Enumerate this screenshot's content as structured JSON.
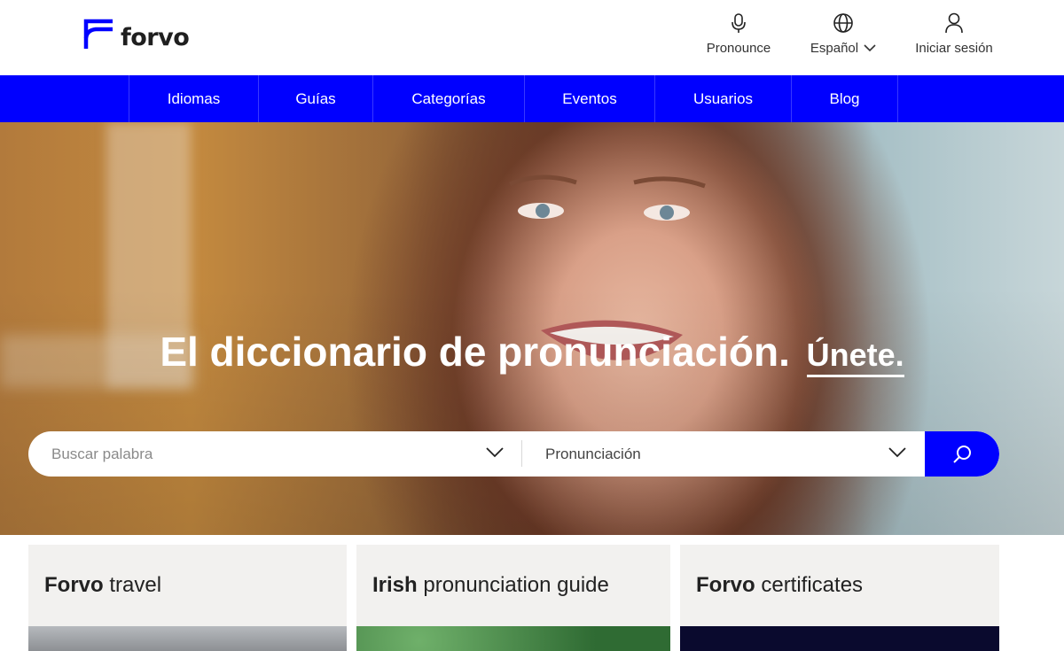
{
  "brand": {
    "name": "forvo",
    "color": "#0000ff"
  },
  "header": {
    "pronounce_label": "Pronounce",
    "language_label": "Español",
    "login_label": "Iniciar sesión"
  },
  "nav": {
    "items": [
      {
        "label": "Idiomas"
      },
      {
        "label": "Guías"
      },
      {
        "label": "Categorías"
      },
      {
        "label": "Eventos"
      },
      {
        "label": "Usuarios"
      },
      {
        "label": "Blog"
      }
    ]
  },
  "hero": {
    "title": "El diccionario de pronunciación.",
    "join_label": "Únete."
  },
  "search": {
    "placeholder": "Buscar palabra",
    "mode_label": "Pronunciación"
  },
  "cards": [
    {
      "title_bold": "Forvo",
      "title_rest": "travel"
    },
    {
      "title_bold": "Irish",
      "title_rest": "pronunciation guide"
    },
    {
      "title_bold": "Forvo",
      "title_rest": "certificates"
    }
  ]
}
